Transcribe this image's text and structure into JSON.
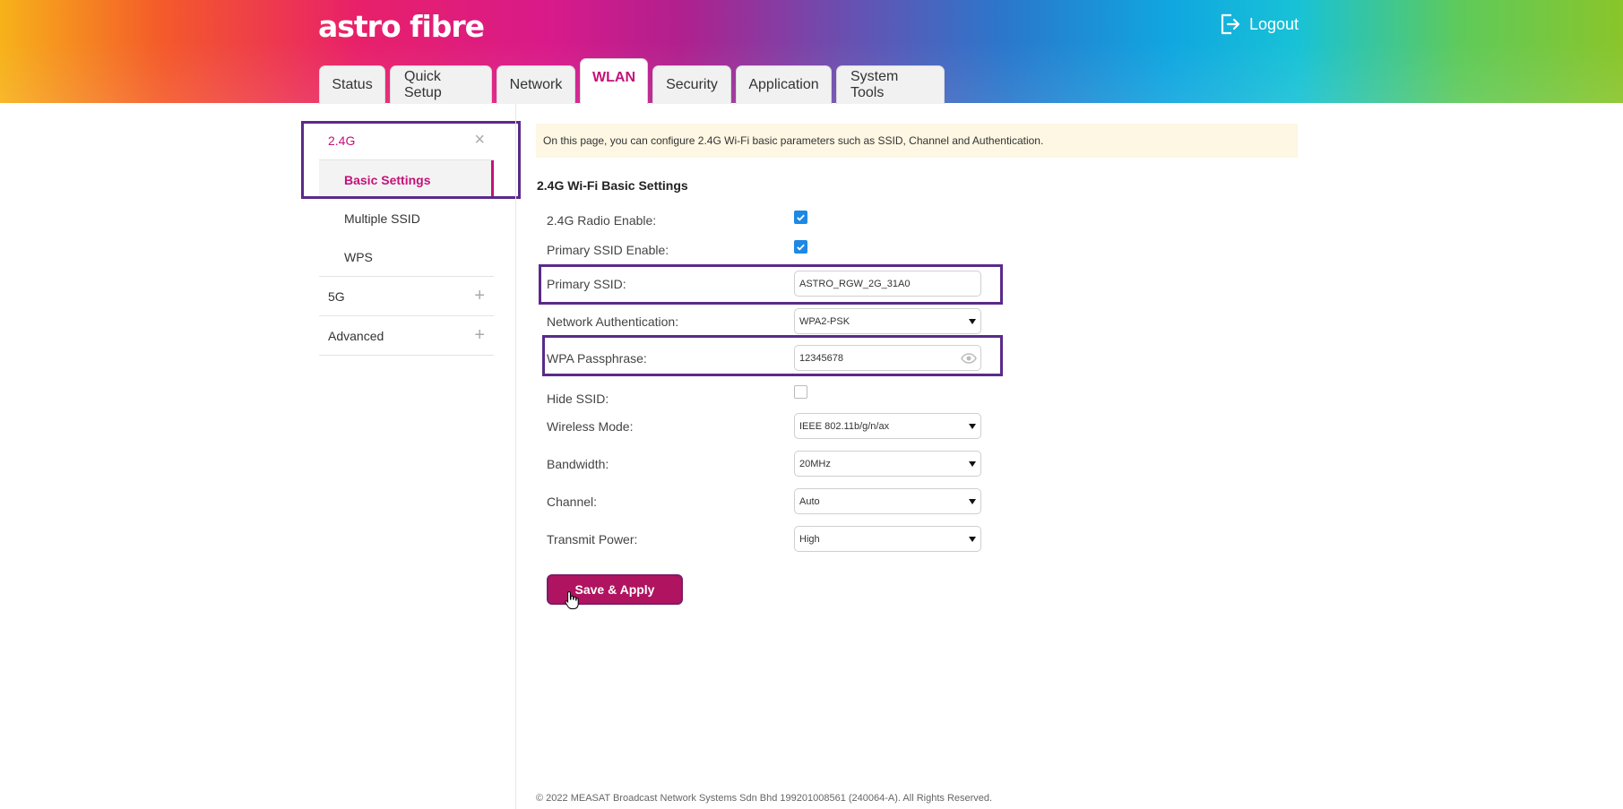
{
  "brand": {
    "logo_text": "astro fibre",
    "logout_label": "Logout"
  },
  "tabs": [
    {
      "label": "Status"
    },
    {
      "label": "Quick Setup"
    },
    {
      "label": "Network"
    },
    {
      "label": "WLAN"
    },
    {
      "label": "Security"
    },
    {
      "label": "Application"
    },
    {
      "label": "System Tools"
    }
  ],
  "active_tab": "WLAN",
  "sidebar": {
    "groups": [
      {
        "label": "2.4G",
        "state": "expanded",
        "items": [
          {
            "label": "Basic Settings",
            "active": true
          },
          {
            "label": "Multiple SSID"
          },
          {
            "label": "WPS"
          }
        ]
      },
      {
        "label": "5G",
        "state": "collapsed"
      },
      {
        "label": "Advanced",
        "state": "collapsed"
      }
    ]
  },
  "notice": "On this page, you can configure 2.4G Wi-Fi basic parameters such as SSID, Channel and Authentication.",
  "section_title": "2.4G Wi-Fi Basic Settings",
  "form": {
    "radio_enable": {
      "label": "2.4G Radio Enable:",
      "checked": true
    },
    "primary_ssid_enable": {
      "label": "Primary SSID Enable:",
      "checked": true
    },
    "primary_ssid": {
      "label": "Primary SSID:",
      "value": "ASTRO_RGW_2G_31A0"
    },
    "network_auth": {
      "label": "Network Authentication:",
      "value": "WPA2-PSK"
    },
    "wpa_passphrase": {
      "label": "WPA Passphrase:",
      "value": "12345678"
    },
    "hide_ssid": {
      "label": "Hide SSID:",
      "checked": false
    },
    "wireless_mode": {
      "label": "Wireless Mode:",
      "value": "IEEE 802.11b/g/n/ax"
    },
    "bandwidth": {
      "label": "Bandwidth:",
      "value": "20MHz"
    },
    "channel": {
      "label": "Channel:",
      "value": "Auto"
    },
    "transmit_power": {
      "label": "Transmit Power:",
      "value": "High"
    }
  },
  "save_button": "Save & Apply",
  "footer": "© 2022 MEASAT Broadcast Network Systems Sdn Bhd 199201008561 (240064-A). All Rights Reserved.",
  "colors": {
    "accent": "#c4127a",
    "highlight_border": "#5a2a8a",
    "button": "#b0135f",
    "checkbox": "#1e88e5"
  }
}
